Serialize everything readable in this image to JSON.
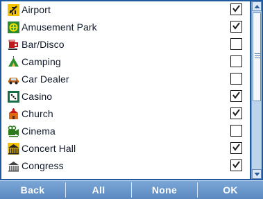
{
  "list": {
    "items": [
      {
        "label": "Airport",
        "checked": true,
        "icon": "airplane-icon"
      },
      {
        "label": "Amusement Park",
        "checked": true,
        "icon": "amusement-park-icon"
      },
      {
        "label": "Bar/Disco",
        "checked": false,
        "icon": "bar-disco-icon"
      },
      {
        "label": "Camping",
        "checked": false,
        "icon": "camping-icon"
      },
      {
        "label": "Car Dealer",
        "checked": false,
        "icon": "car-dealer-icon"
      },
      {
        "label": "Casino",
        "checked": true,
        "icon": "casino-icon"
      },
      {
        "label": "Church",
        "checked": true,
        "icon": "church-icon"
      },
      {
        "label": "Cinema",
        "checked": false,
        "icon": "cinema-icon"
      },
      {
        "label": "Concert Hall",
        "checked": true,
        "icon": "concert-hall-icon"
      },
      {
        "label": "Congress",
        "checked": true,
        "icon": "congress-icon"
      }
    ]
  },
  "toolbar": {
    "back_label": "Back",
    "all_label": "All",
    "none_label": "None",
    "ok_label": "OK"
  },
  "colors": {
    "frame": "#1f5aa0",
    "toolbar": "#6a97cc",
    "scrollbar": "#bcd3ec"
  }
}
